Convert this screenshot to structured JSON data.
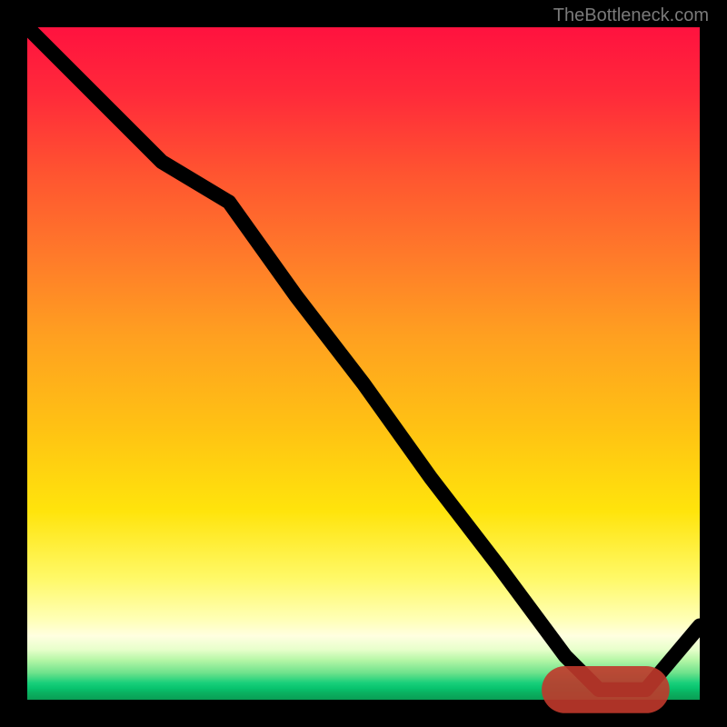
{
  "attribution": "TheBottleneck.com",
  "chart_data": {
    "type": "line",
    "title": "",
    "xlabel": "",
    "ylabel": "",
    "x": [
      0,
      10,
      20,
      30,
      40,
      50,
      60,
      70,
      80,
      85,
      92,
      100
    ],
    "values": [
      100,
      90,
      80,
      74,
      60,
      47,
      33,
      20,
      6.5,
      1.5,
      1.5,
      11
    ],
    "xlim": [
      0,
      100
    ],
    "ylim": [
      0,
      100
    ],
    "flat_region": {
      "x_start": 80,
      "x_end": 92,
      "y": 1.5
    },
    "background": {
      "gradient_stops": [
        {
          "pos": 0.0,
          "color": "#ff123f"
        },
        {
          "pos": 0.5,
          "color": "#ffb91a"
        },
        {
          "pos": 0.8,
          "color": "#fff24a"
        },
        {
          "pos": 0.92,
          "color": "#e5ffc6"
        },
        {
          "pos": 1.0,
          "color": "#0a9e55"
        }
      ]
    }
  }
}
